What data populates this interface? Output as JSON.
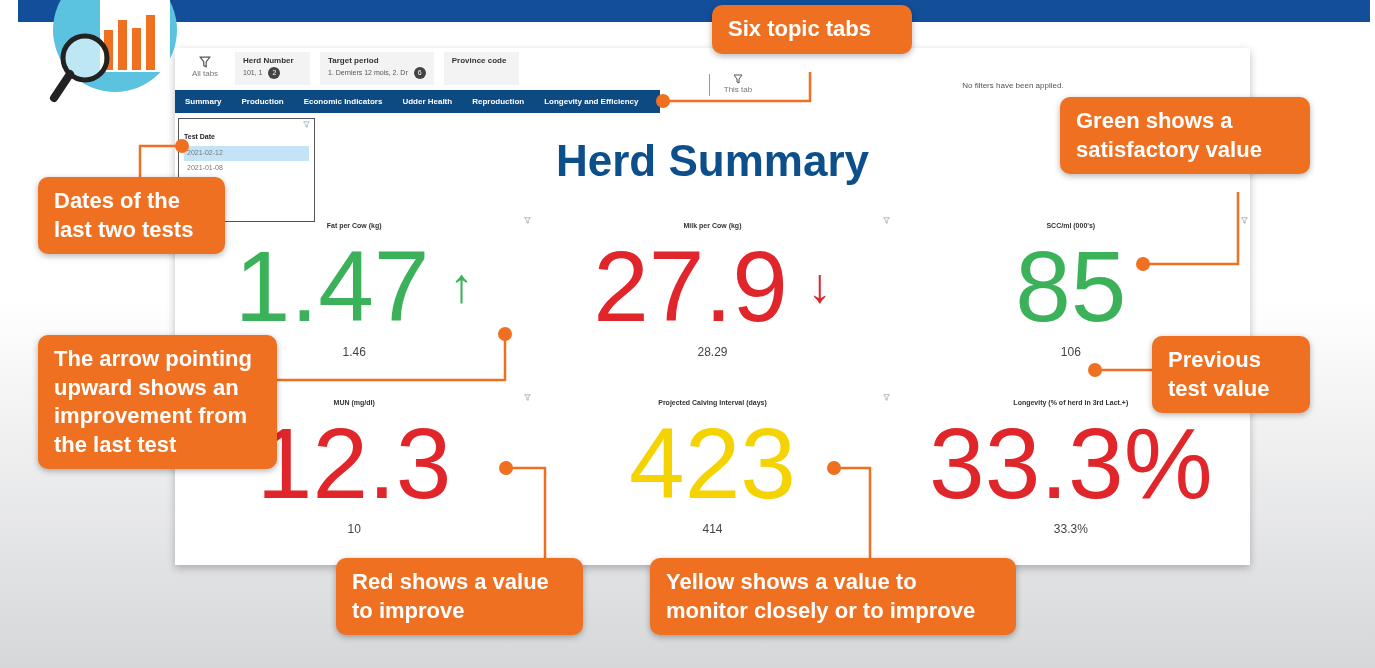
{
  "filter_bar": {
    "all_tabs_label": "All tabs",
    "filters": [
      {
        "label": "Herd Number",
        "value": "101, 1",
        "count": "2"
      },
      {
        "label": "Target period",
        "value": "1. Derniers 12 mois, 2. Dr",
        "count": "6"
      },
      {
        "label": "Province code"
      }
    ],
    "this_tab_label": "This tab",
    "status": "No filters have been applied."
  },
  "tabs": [
    "Summary",
    "Production",
    "Economic Indicators",
    "Udder Health",
    "Reproduction",
    "Longevity and Efficiency"
  ],
  "test_date": {
    "title": "Test Date",
    "items": [
      {
        "label": "2021-02-12",
        "selected": true
      },
      {
        "label": "2021-01-08",
        "selected": false
      }
    ]
  },
  "title": "Herd Summary",
  "metrics": [
    {
      "title": "Fat per Cow (kg)",
      "value": "1.47",
      "color": "#3bb15a",
      "arrow": "↑",
      "previous": "1.46"
    },
    {
      "title": "Milk per Cow (kg)",
      "value": "27.9",
      "color": "#e1262b",
      "arrow": "↓",
      "previous": "28.29"
    },
    {
      "title": "SCC/ml (000's)",
      "value": "85",
      "color": "#3bb15a",
      "previous": "106"
    },
    {
      "title": "MUN (mg/dl)",
      "value": "12.3",
      "color": "#e1262b",
      "previous": "10"
    },
    {
      "title": "Projected Calving Interval (days)",
      "value": "423",
      "color": "#f5d300",
      "previous": "414"
    },
    {
      "title": "Longevity (% of herd in 3rd Lact.+)",
      "value": "33.3%",
      "color": "#e1262b",
      "previous": "33.3%"
    }
  ],
  "callouts": [
    {
      "text": "Six topic tabs"
    },
    {
      "text": "Green shows a satisfactory value"
    },
    {
      "text": "Dates of the last two tests"
    },
    {
      "text": "The arrow pointing upward shows an improvement from the last test"
    },
    {
      "text": "Previous test value"
    },
    {
      "text": "Red shows a value to improve"
    },
    {
      "text": "Yellow shows a value to monitor  closely or to improve"
    }
  ]
}
